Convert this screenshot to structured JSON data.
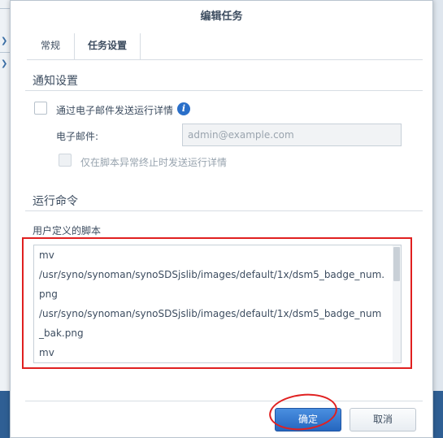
{
  "dialog": {
    "title": "编辑任务",
    "tabs": [
      {
        "label": "常规"
      },
      {
        "label": "任务设置"
      }
    ]
  },
  "notify": {
    "section_title": "通知设置",
    "email_checkbox_label": "通过电子邮件发送运行详情",
    "email_label": "电子邮件:",
    "email_placeholder": "admin@example.com",
    "abnormal_only_label": "仅在脚本异常终止时发送运行详情"
  },
  "run": {
    "section_title": "运行命令",
    "script_label": "用户定义的脚本",
    "script_lines": [
      "mv",
      "/usr/syno/synoman/synoSDSjslib/images/default/1x/dsm5_badge_num.",
      "png",
      "/usr/syno/synoman/synoSDSjslib/images/default/1x/dsm5_badge_num",
      "_bak.png",
      "mv"
    ]
  },
  "buttons": {
    "ok": "确定",
    "cancel": "取消"
  },
  "colors": {
    "primary": "#2566bf",
    "annotation_red": "#e02020",
    "text": "#3d4d60"
  },
  "icons": {
    "info": "info-icon",
    "chevron": "chevron-down-icon"
  }
}
